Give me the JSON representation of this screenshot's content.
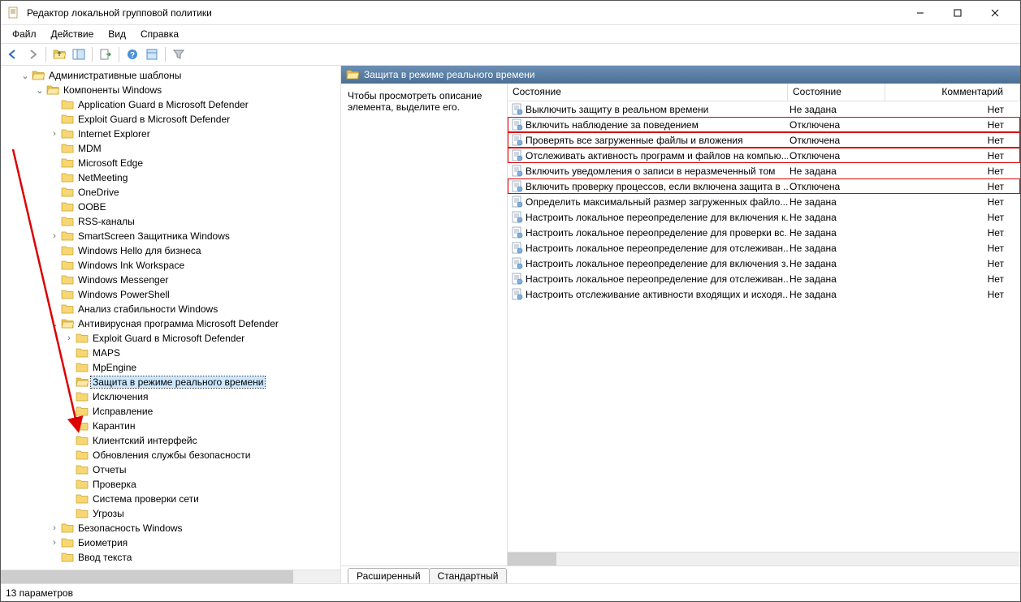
{
  "window": {
    "title": "Редактор локальной групповой политики"
  },
  "menu": {
    "file": "Файл",
    "action": "Действие",
    "view": "Вид",
    "help": "Справка"
  },
  "tree": {
    "root": "Административные шаблоны",
    "win_components": "Компоненты Windows",
    "items_level3_top": [
      "Application Guard в Microsoft Defender",
      "Exploit Guard в Microsoft Defender",
      "Internet Explorer",
      "MDM",
      "Microsoft Edge",
      "NetMeeting",
      "OneDrive",
      "OOBE",
      "RSS-каналы",
      "SmartScreen Защитника Windows",
      "Windows Hello для бизнеса",
      "Windows Ink Workspace",
      "Windows Messenger",
      "Windows PowerShell",
      "Анализ стабильности Windows",
      "Антивирусная программа Microsoft Defender"
    ],
    "defender_children": [
      "Exploit Guard в Microsoft Defender",
      "MAPS",
      "MpEngine",
      "Защита в режиме реального времени",
      "Исключения",
      "Исправление",
      "Карантин",
      "Клиентский интерфейс",
      "Обновления службы безопасности",
      "Отчеты",
      "Проверка",
      "Система проверки сети",
      "Угрозы"
    ],
    "items_level3_bottom": [
      "Безопасность Windows",
      "Биометрия",
      "Ввод текста"
    ]
  },
  "panel": {
    "header": "Защита в режиме реального времени",
    "desc": "Чтобы просмотреть описание элемента, выделите его.",
    "col_name": "Состояние",
    "col_state": "Состояние",
    "col_comment": "Комментарий"
  },
  "rows": [
    {
      "name": "Выключить защиту в реальном времени",
      "state": "Не задана",
      "comment": "Нет",
      "hl": false
    },
    {
      "name": "Включить наблюдение за поведением",
      "state": "Отключена",
      "comment": "Нет",
      "hl": true
    },
    {
      "name": "Проверять все загруженные файлы и вложения",
      "state": "Отключена",
      "comment": "Нет",
      "hl": true
    },
    {
      "name": "Отслеживать активность программ и файлов на компью...",
      "state": "Отключена",
      "comment": "Нет",
      "hl": true
    },
    {
      "name": "Включить уведомления о записи в неразмеченный том",
      "state": "Не задана",
      "comment": "Нет",
      "hl": false
    },
    {
      "name": "Включить проверку процессов, если включена защита в ...",
      "state": "Отключена",
      "comment": "Нет",
      "hl": true
    },
    {
      "name": "Определить максимальный размер загруженных файло...",
      "state": "Не задана",
      "comment": "Нет",
      "hl": false
    },
    {
      "name": "Настроить локальное переопределение для включения к...",
      "state": "Не задана",
      "comment": "Нет",
      "hl": false
    },
    {
      "name": "Настроить локальное переопределение для проверки вс...",
      "state": "Не задана",
      "comment": "Нет",
      "hl": false
    },
    {
      "name": "Настроить локальное переопределение для отслеживан...",
      "state": "Не задана",
      "comment": "Нет",
      "hl": false
    },
    {
      "name": "Настроить локальное переопределение для включения з...",
      "state": "Не задана",
      "comment": "Нет",
      "hl": false
    },
    {
      "name": "Настроить локальное переопределение для отслеживан...",
      "state": "Не задана",
      "comment": "Нет",
      "hl": false
    },
    {
      "name": "Настроить отслеживание активности входящих и исходя...",
      "state": "Не задана",
      "comment": "Нет",
      "hl": false
    }
  ],
  "tabs": {
    "extended": "Расширенный",
    "standard": "Стандартный"
  },
  "status": "13 параметров"
}
